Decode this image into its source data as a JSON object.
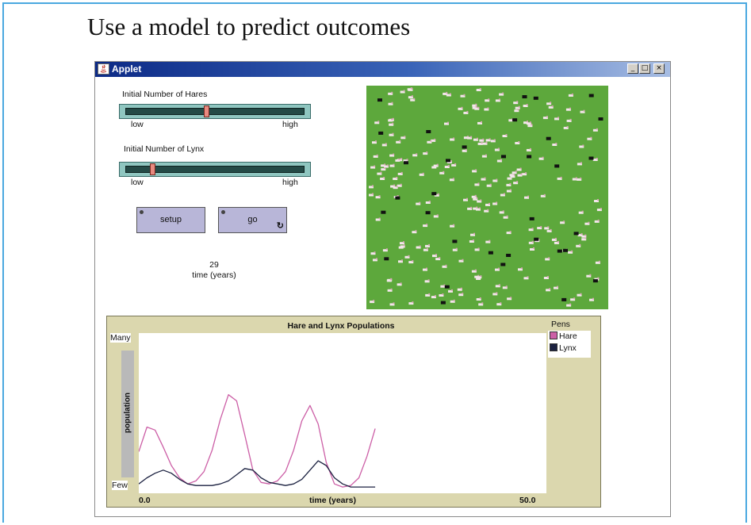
{
  "slide": {
    "title": "Use a model to predict outcomes"
  },
  "window": {
    "title": "Applet",
    "minimize": "_",
    "maximize": "□",
    "close": "×"
  },
  "controls": {
    "hares_label": "Initial Number of Hares",
    "hares_value": 0.45,
    "lynx_label": "Initial Number of Lynx",
    "lynx_value": 0.14,
    "low": "low",
    "high": "high",
    "setup_label": "setup",
    "go_label": "go"
  },
  "counter": {
    "value": "29",
    "label": "time (years)"
  },
  "colors": {
    "world": "#5da83c",
    "hare": "#cc5fa6",
    "lynx": "#1b2140"
  },
  "plot": {
    "title": "Hare and Lynx Populations"
  },
  "chart_data": {
    "type": "line",
    "title": "Hare and Lynx Populations",
    "xlabel": "time (years)",
    "ylabel": "population",
    "xlim": [
      0,
      50
    ],
    "ylim": [
      0,
      100
    ],
    "x_tick_labels": [
      "0.0",
      "50.0"
    ],
    "y_tick_labels": [
      "Few",
      "Many"
    ],
    "legend_title": "Pens",
    "legend_position": "right",
    "series": [
      {
        "name": "Hare",
        "color": "#cc5fa6",
        "x": [
          0,
          1,
          2,
          3,
          4,
          5,
          6,
          7,
          8,
          9,
          10,
          11,
          12,
          13,
          14,
          15,
          16,
          17,
          18,
          19,
          20,
          21,
          22,
          23,
          24,
          25,
          26,
          27,
          28,
          29
        ],
        "y": [
          25,
          41,
          39,
          28,
          16,
          8,
          4,
          6,
          12,
          26,
          46,
          62,
          58,
          36,
          13,
          5,
          4,
          6,
          12,
          26,
          45,
          55,
          43,
          18,
          4,
          2,
          3,
          8,
          22,
          40
        ]
      },
      {
        "name": "Lynx",
        "color": "#1b2140",
        "x": [
          0,
          1,
          2,
          3,
          4,
          5,
          6,
          7,
          8,
          9,
          10,
          11,
          12,
          13,
          14,
          15,
          16,
          17,
          18,
          19,
          20,
          21,
          22,
          23,
          24,
          25,
          26,
          27,
          28,
          29
        ],
        "y": [
          4,
          8,
          11,
          13,
          11,
          7,
          4,
          3,
          3,
          3,
          4,
          6,
          10,
          14,
          13,
          8,
          5,
          4,
          3,
          4,
          7,
          13,
          19,
          16,
          8,
          4,
          2,
          2,
          2,
          2
        ]
      }
    ]
  }
}
